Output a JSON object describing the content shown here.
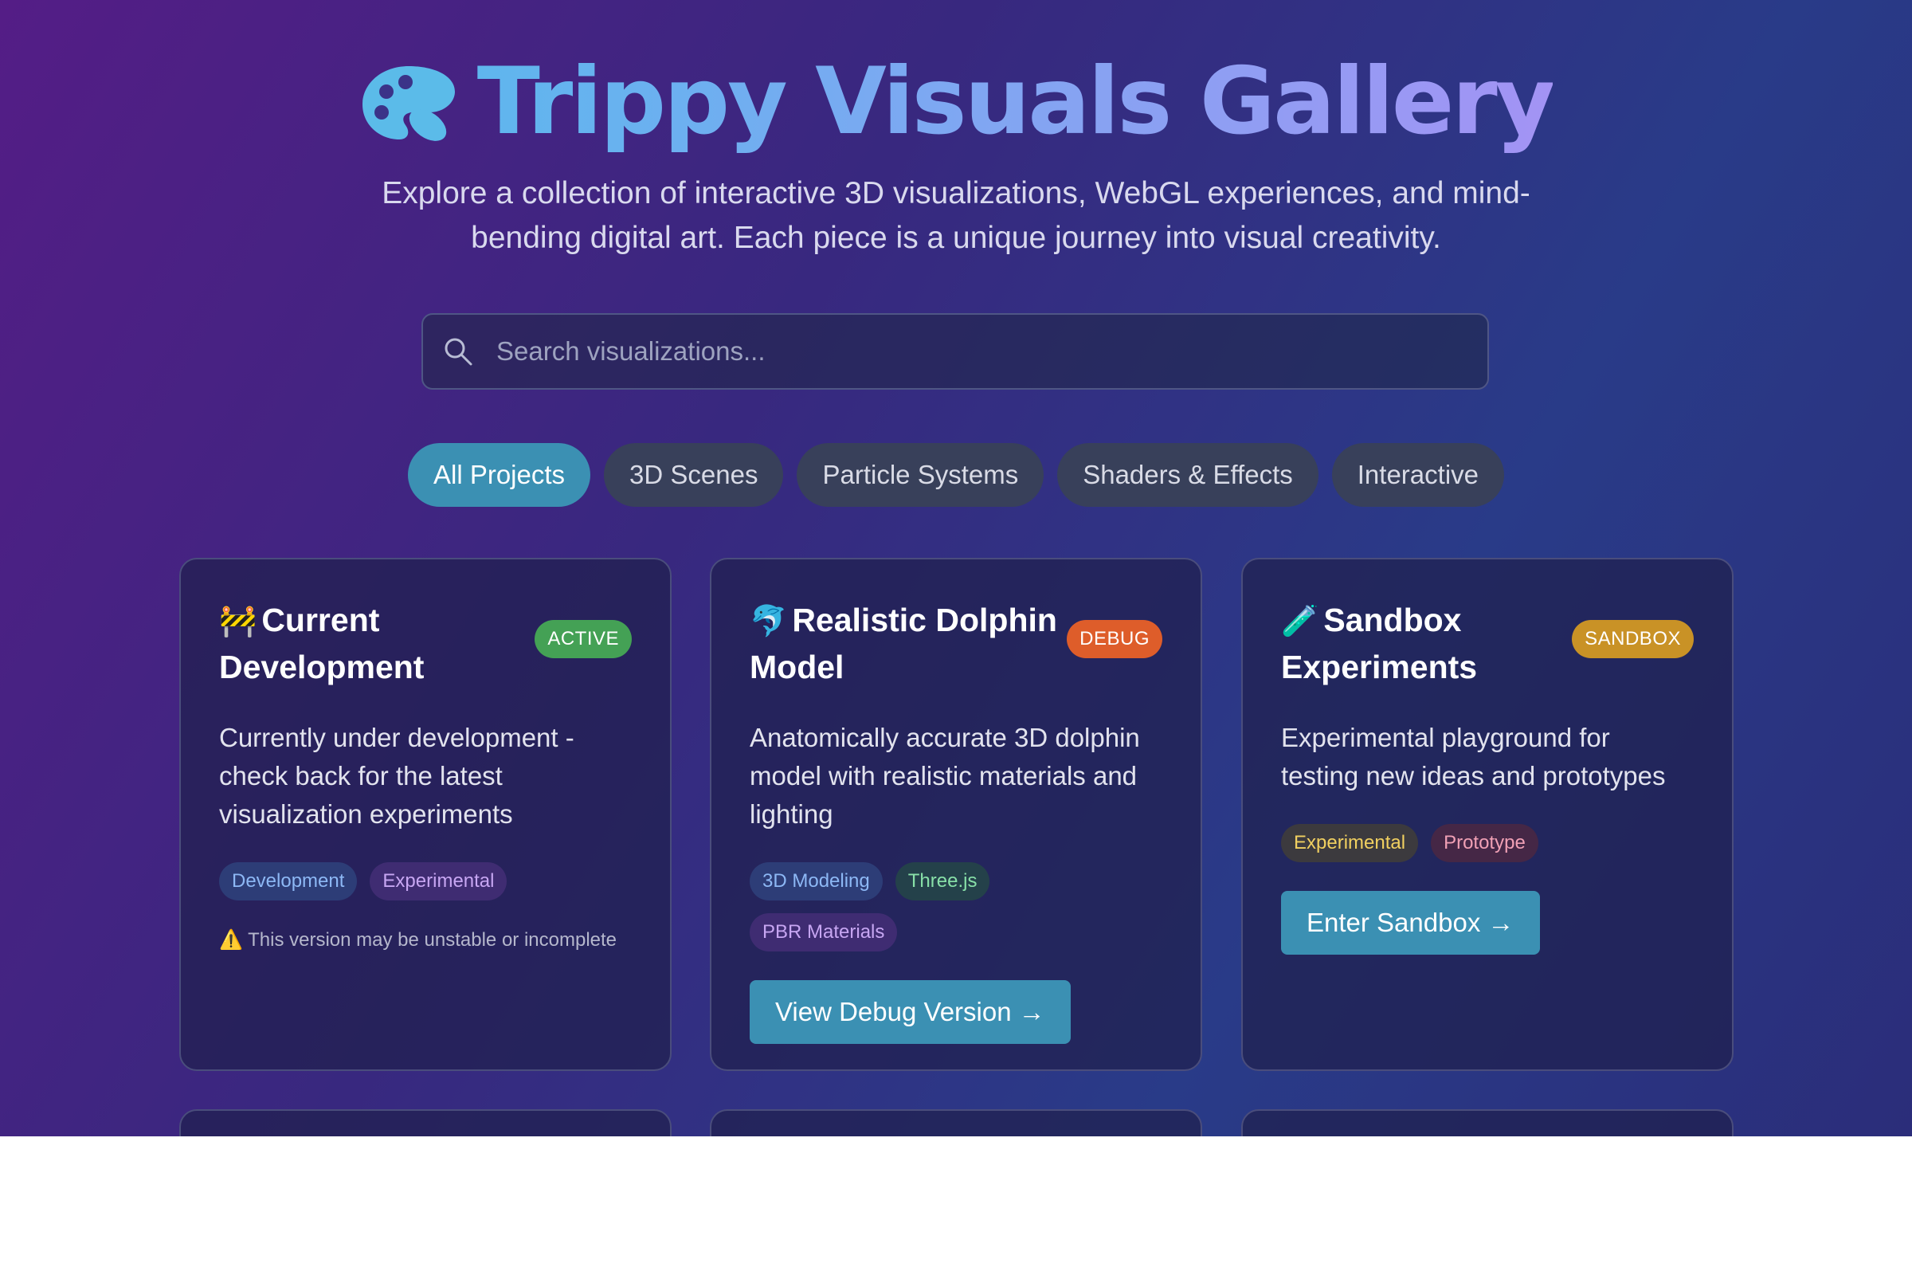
{
  "header": {
    "title": "Trippy Visuals Gallery",
    "title_icon": "palette-icon",
    "subtitle": "Explore a collection of interactive 3D visualizations, WebGL experiences, and mind-bending digital art. Each piece is a unique journey into visual creativity."
  },
  "search": {
    "placeholder": "Search visualizations...",
    "icon": "search-icon"
  },
  "filters": [
    {
      "label": "All Projects",
      "active": true
    },
    {
      "label": "3D Scenes",
      "active": false
    },
    {
      "label": "Particle Systems",
      "active": false
    },
    {
      "label": "Shaders & Effects",
      "active": false
    },
    {
      "label": "Interactive",
      "active": false
    }
  ],
  "cards": [
    {
      "emoji": "🚧",
      "title": "Current Development",
      "badge": "ACTIVE",
      "badge_color": "#44a155",
      "description": "Currently under development - check back for the latest visualization experiments",
      "tags": [
        "Development",
        "Experimental"
      ],
      "note_icon": "⚠️",
      "note": "This version may be unstable or incomplete"
    },
    {
      "emoji": "🐬",
      "title": "Realistic Dolphin Model",
      "badge": "DEBUG",
      "badge_color": "#de5d2a",
      "description": "Anatomically accurate 3D dolphin model with realistic materials and lighting",
      "tags": [
        "3D Modeling",
        "Three.js",
        "PBR Materials"
      ],
      "button": "View Debug Version →"
    },
    {
      "emoji": "🧪",
      "title": "Sandbox Experiments",
      "badge": "SANDBOX",
      "badge_color": "#c99226",
      "description": "Experimental playground for testing new ideas and prototypes",
      "tags": [
        "Experimental",
        "Prototype"
      ],
      "button": "Enter Sandbox →"
    }
  ],
  "colors": {
    "accent": "#3b90b3",
    "background_start": "#541d86",
    "background_end": "#2b2d7a"
  }
}
